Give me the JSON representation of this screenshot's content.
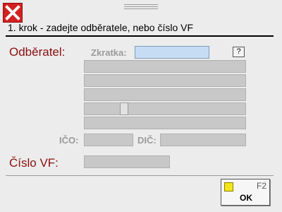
{
  "window": {
    "close_icon": "close-x-icon"
  },
  "step": {
    "title": "1. krok - zadejte odběratele, nebo číslo VF"
  },
  "customer": {
    "label": "Odběratel:",
    "shortcut_label": "Zkratka:",
    "shortcut_value": "",
    "help_label": "?",
    "ico_label": "IČO:",
    "dic_label": "DIČ:"
  },
  "invoice": {
    "label": "Číslo VF:",
    "value": ""
  },
  "actions": {
    "ok_label": "OK",
    "ok_key": "F2",
    "ok_icon": "yellow-square-icon"
  },
  "colors": {
    "accent_red": "#8b1010",
    "close_red": "#d32020",
    "active_field": "#c6dcf5",
    "ok_icon": "#f5e61a"
  }
}
